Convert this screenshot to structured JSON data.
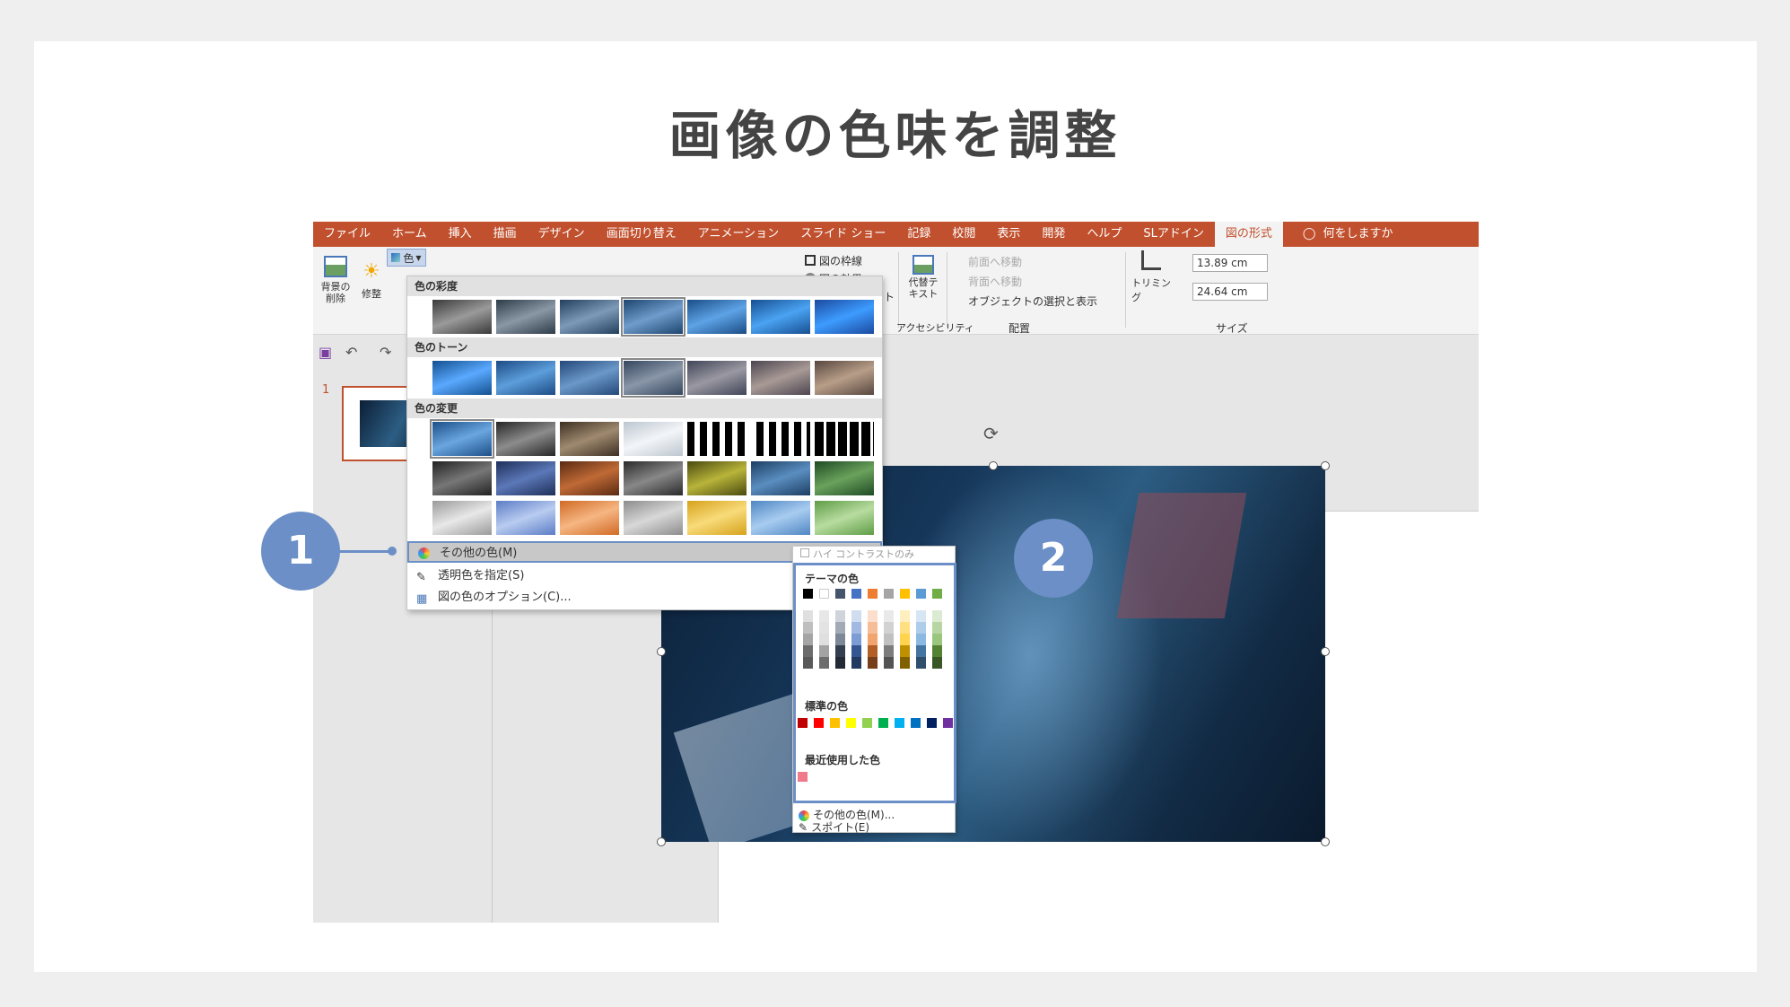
{
  "title": "画像の色味を調整",
  "tabs": [
    "ファイル",
    "ホーム",
    "挿入",
    "描画",
    "デザイン",
    "画面切り替え",
    "アニメーション",
    "スライド ショー",
    "記録",
    "校閲",
    "表示",
    "開発",
    "ヘルプ",
    "SLアドイン",
    "図の形式"
  ],
  "active_tab": "図の形式",
  "tell_me": "何をしますか",
  "ribbon": {
    "remove_bg": "背景の\n削除",
    "corrections": "修整",
    "color": "色",
    "border": "図の枠線",
    "effects": "図の効果",
    "layout": "図のレイアウト",
    "alt_text": "代替テ\nキスト",
    "accessibility": "アクセシビリティ",
    "bring_forward": "前面へ移動",
    "send_backward": "背面へ移動",
    "selection_pane": "オブジェクトの選択と表示",
    "arrange": "配置",
    "crop": "トリミング",
    "height": "13.89 cm",
    "width": "24.64 cm",
    "size": "サイズ"
  },
  "thumb": {
    "slide_number": "1"
  },
  "menu": {
    "saturation": "色の彩度",
    "tone": "色のトーン",
    "recolor": "色の変更",
    "more_colors": "その他の色(M)",
    "set_transparent": "透明色を指定(S)",
    "color_options": "図の色のオプション(C)..."
  },
  "submenu": {
    "high_contrast": "ハイ コントラストのみ",
    "theme_colors": "テーマの色",
    "standard_colors": "標準の色",
    "recent_colors": "最近使用した色",
    "more_colors": "その他の色(M)...",
    "eyedropper": "スポイト(E)"
  },
  "colors": {
    "theme": [
      "#000000",
      "#ffffff",
      "#44546a",
      "#4472c4",
      "#ed7d31",
      "#a5a5a5",
      "#ffc000",
      "#5b9bd5",
      "#70ad47"
    ],
    "standard": [
      "#c00000",
      "#ff0000",
      "#ffc000",
      "#ffff00",
      "#92d050",
      "#00b050",
      "#00b0f0",
      "#0070c0",
      "#002060",
      "#7030a0"
    ],
    "recent": [
      "#f07a8a"
    ],
    "accent": "#c1502e",
    "callout": "#6b8fc6"
  },
  "callouts": [
    "1",
    "2"
  ]
}
